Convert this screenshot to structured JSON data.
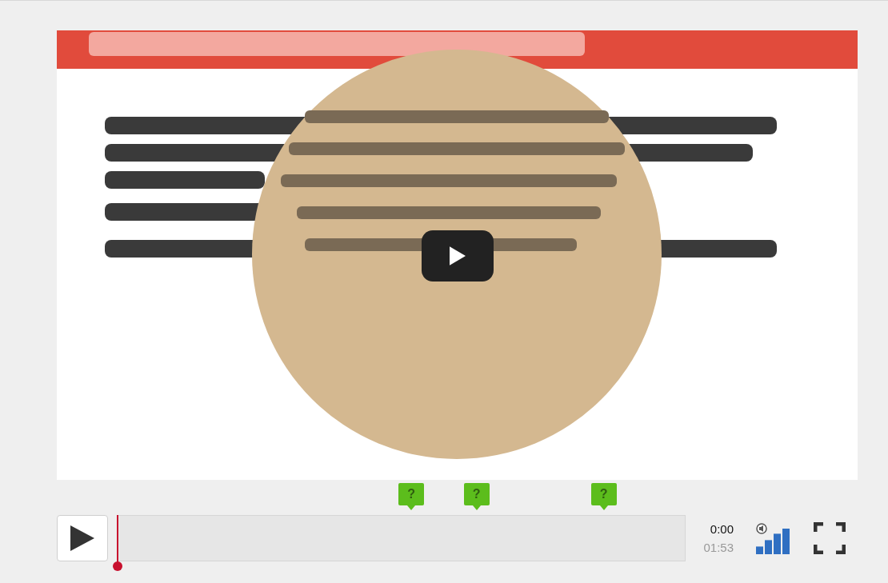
{
  "markers": [
    {
      "label": "?"
    },
    {
      "label": "?"
    },
    {
      "label": "?"
    }
  ],
  "time": {
    "current": "0:00",
    "duration": "01:53"
  }
}
